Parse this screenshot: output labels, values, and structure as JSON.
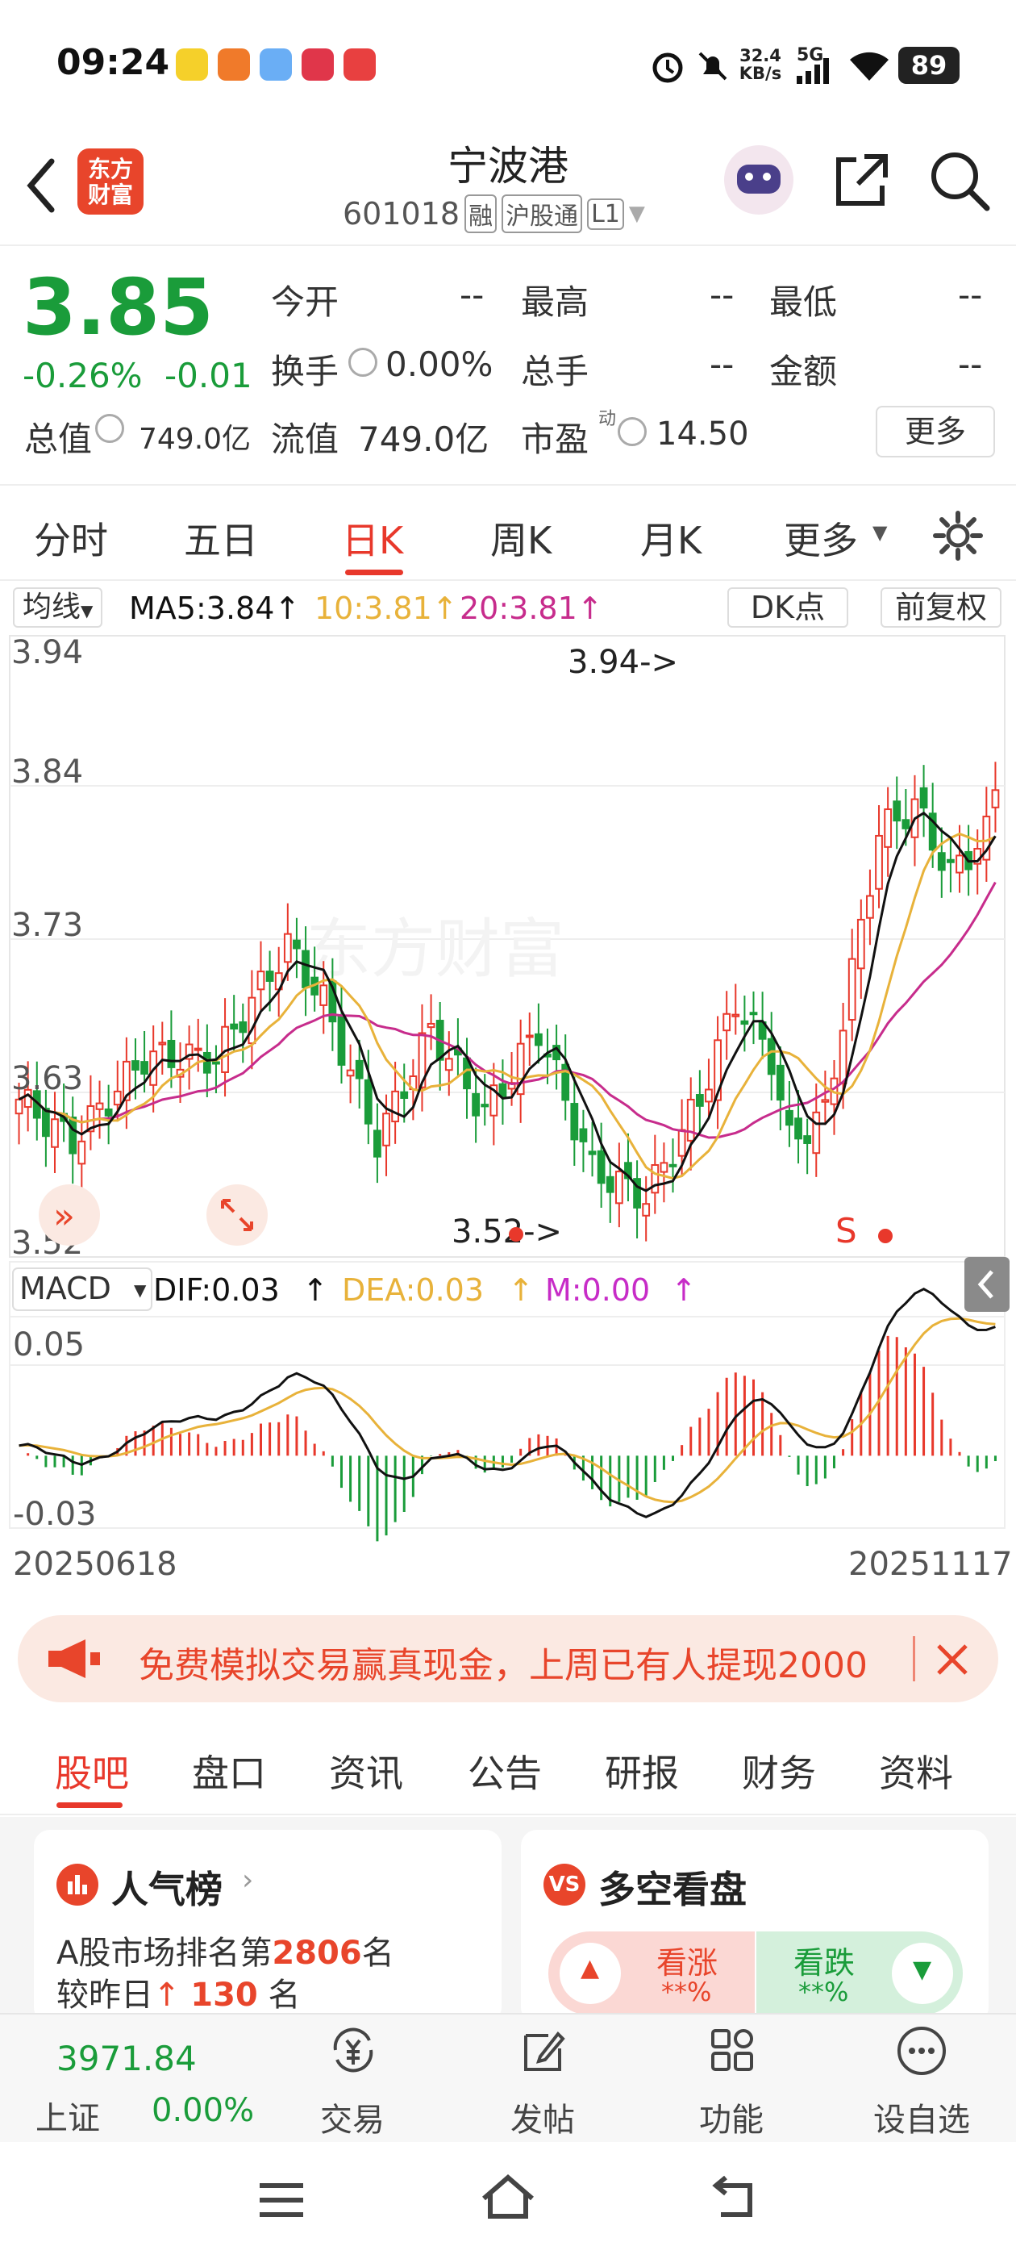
{
  "status_bar": {
    "time": "09:24",
    "net_speed_top": "32.4",
    "net_speed_bottom": "KB/s",
    "network": "5G",
    "battery": "89"
  },
  "nav": {
    "title": "宁波港",
    "code": "601018",
    "tag_rong": "融",
    "tag_hgt": "沪股通",
    "tag_level": "L1",
    "logo_line1": "东方",
    "logo_line2": "财富"
  },
  "quote": {
    "price": "3.85",
    "change_pct": "-0.26%",
    "change": "-0.01",
    "open_label": "今开",
    "open": "--",
    "high_label": "最高",
    "high": "--",
    "low_label": "最低",
    "low": "--",
    "turnover_label": "换手",
    "turnover": "0.00%",
    "volume_label": "总手",
    "volume": "--",
    "amount_label": "金额",
    "amount": "--",
    "mktcap_label": "总值",
    "mktcap": "749.0亿",
    "float_label": "流值",
    "float": "749.0亿",
    "pe_label": "市盈",
    "pe_sup": "动",
    "pe": "14.50",
    "more_button": "更多"
  },
  "period_tabs": [
    "分时",
    "五日",
    "日K",
    "周K",
    "月K",
    "更多"
  ],
  "active_period": "日K",
  "ma_row": {
    "selector": "均线",
    "ma5": "MA5:3.84",
    "ma10": "10:3.81",
    "ma20": "20:3.81",
    "dk": "DK点",
    "fq": "前复权"
  },
  "kline": {
    "y_labels": [
      "3.94",
      "3.84",
      "3.73",
      "3.63",
      "3.52"
    ],
    "high_marker": "3.94->",
    "low_marker": "3.52->",
    "signal": "S",
    "watermark": "东方财富"
  },
  "macd_row": {
    "selector": "MACD",
    "dif": "DIF:0.03",
    "dea": "DEA:0.03",
    "m": "M:0.00",
    "y_top": "0.05",
    "y_bottom": "-0.03",
    "date_start": "20250618",
    "date_end": "20251117"
  },
  "banner": {
    "text": "免费模拟交易赢真现金，上周已有人提现2000"
  },
  "content_tabs": [
    "股吧",
    "盘口",
    "资讯",
    "公告",
    "研报",
    "财务",
    "资料"
  ],
  "active_content_tab": "股吧",
  "popularity": {
    "title": "人气榜",
    "rank_prefix": "A股市场排名第",
    "rank": "2806",
    "rank_suffix": "名",
    "compare_prefix": "较昨日",
    "compare_value": "130",
    "compare_suffix": "名"
  },
  "sentiment": {
    "title": "多空看盘",
    "up_label": "看涨",
    "up_value": "**%",
    "down_label": "看跌",
    "down_value": "**%"
  },
  "bottom_bar": {
    "index_value": "3971.84",
    "index_name": "上证",
    "index_change": "0.00%",
    "trade": "交易",
    "post": "发帖",
    "functions": "功能",
    "watchlist": "设自选"
  },
  "colors": {
    "up": "#e8382b",
    "down": "#1a9c3a",
    "accent": "#e8382b",
    "ma5": "#111111",
    "ma10": "#e8b23a",
    "ma20": "#c72c8c"
  }
}
